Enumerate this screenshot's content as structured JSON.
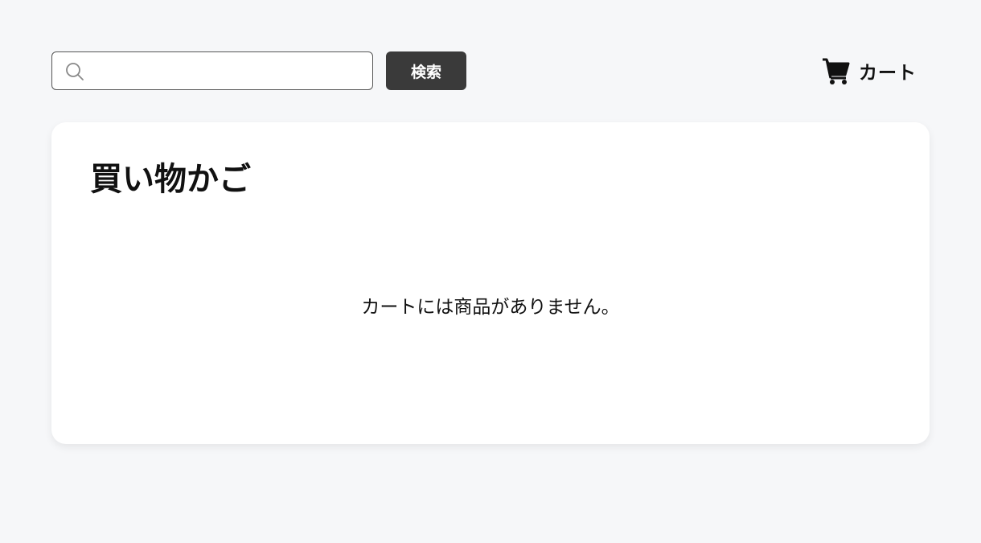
{
  "header": {
    "search": {
      "value": "",
      "placeholder": "",
      "icon": "search-icon"
    },
    "search_button_label": "検索",
    "cart": {
      "icon": "cart-icon",
      "label": "カート"
    }
  },
  "main": {
    "title": "買い物かご",
    "empty_message": "カートには商品がありません。"
  },
  "colors": {
    "background": "#f6f7f9",
    "card": "#ffffff",
    "button": "#3a3a3a",
    "text": "#111111"
  }
}
